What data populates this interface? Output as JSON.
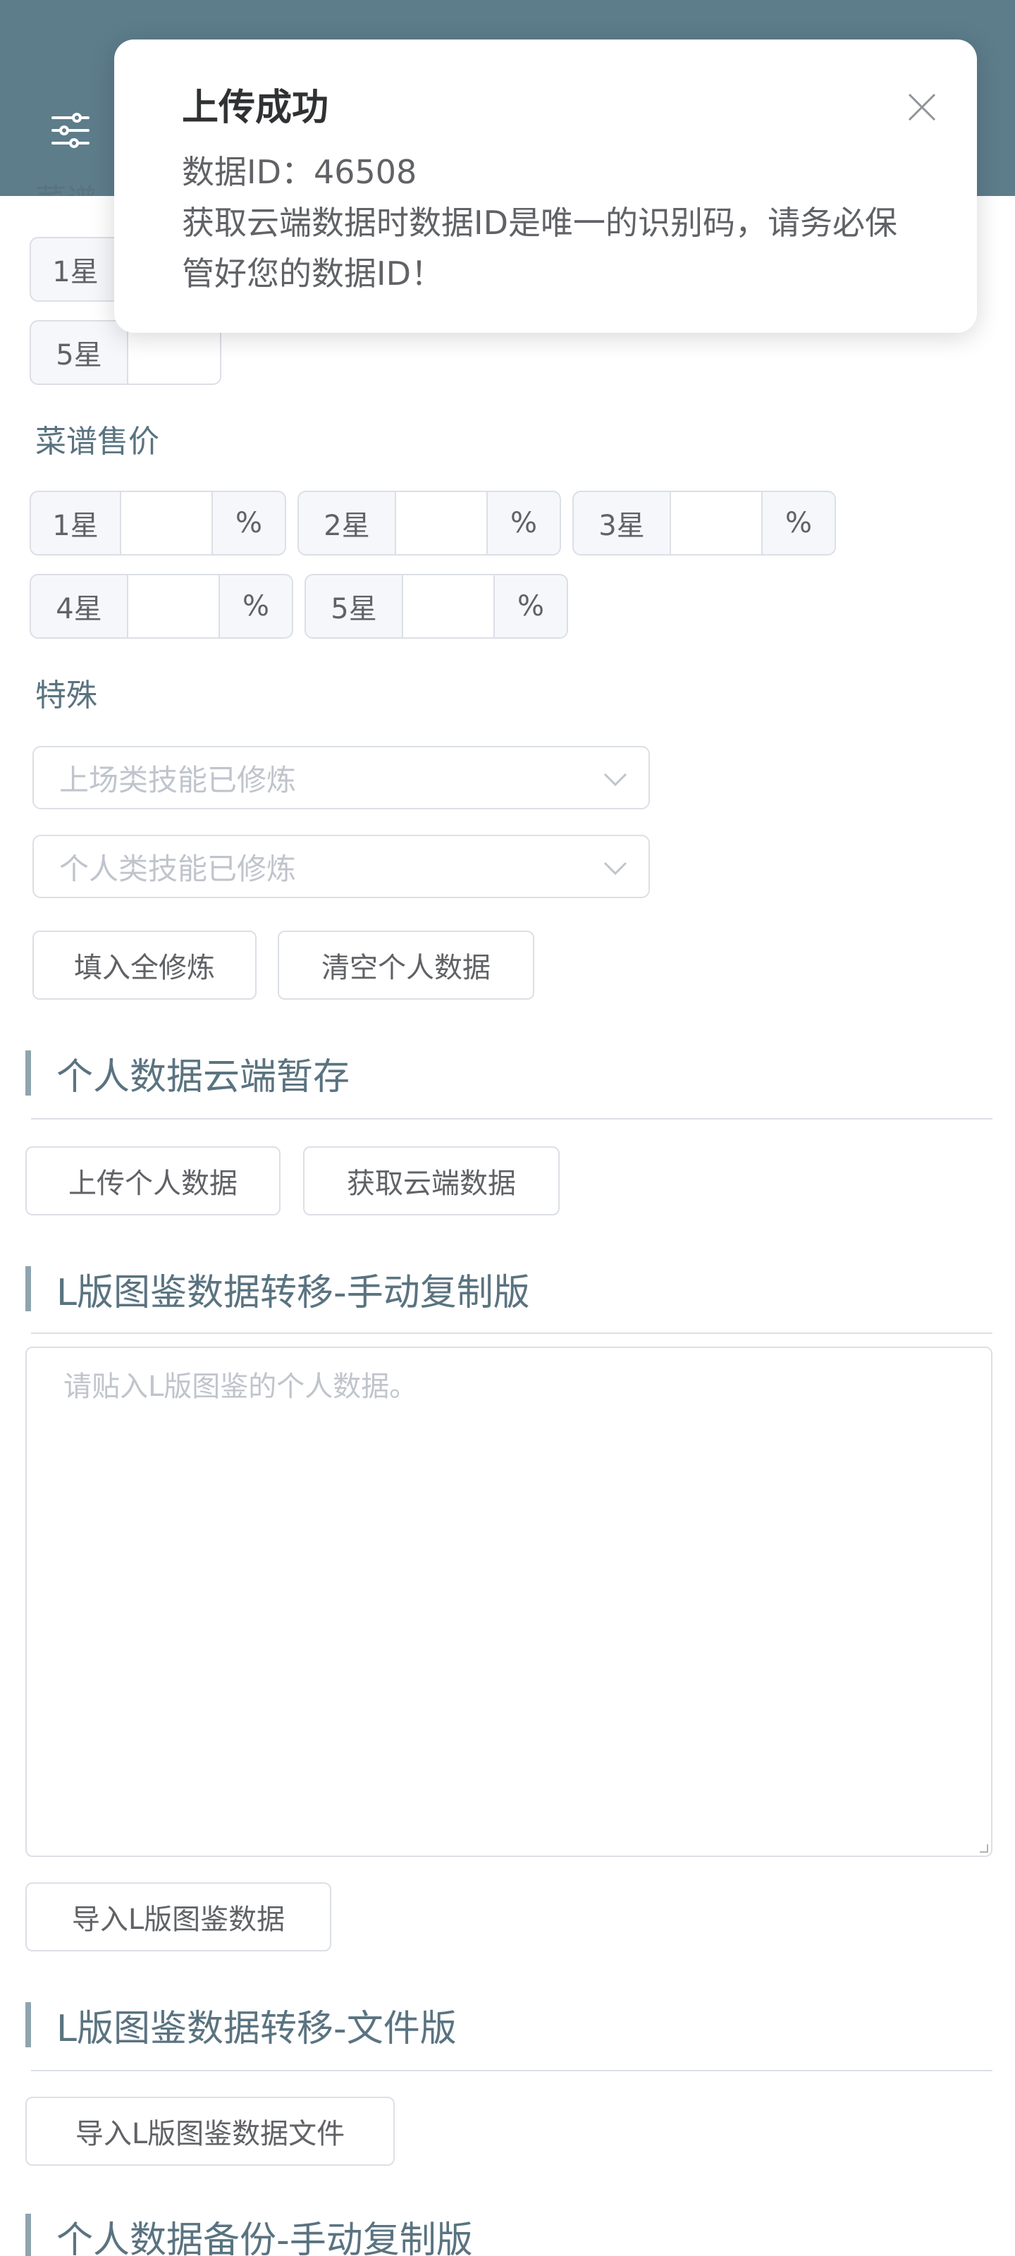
{
  "header": {
    "menu_icon": "sliders-icon",
    "background": "#5d7d8b"
  },
  "partial_top_label": "菜谱…",
  "rows_top": [
    {
      "prefix": "1星"
    },
    {
      "prefix": "5星"
    }
  ],
  "recipe_price": {
    "label": "菜谱售价",
    "items": [
      {
        "prefix": "1星",
        "suffix": "%"
      },
      {
        "prefix": "2星",
        "suffix": "%"
      },
      {
        "prefix": "3星",
        "suffix": "%"
      },
      {
        "prefix": "4星",
        "suffix": "%"
      },
      {
        "prefix": "5星",
        "suffix": "%"
      }
    ]
  },
  "special": {
    "label": "特殊",
    "select1_placeholder": "上场类技能已修炼",
    "select2_placeholder": "个人类技能已修炼",
    "btn_fill_all": "填入全修炼",
    "btn_clear": "清空个人数据"
  },
  "cloud": {
    "title": "个人数据云端暂存",
    "btn_upload": "上传个人数据",
    "btn_fetch": "获取云端数据"
  },
  "l_manual": {
    "title": "L版图鉴数据转移-手动复制版",
    "textarea_placeholder": "请贴入L版图鉴的个人数据。",
    "btn_import": "导入L版图鉴数据"
  },
  "l_file": {
    "title": "L版图鉴数据转移-文件版",
    "btn_import_file": "导入L版图鉴数据文件"
  },
  "backup": {
    "title": "个人数据备份-手动复制版"
  },
  "toast": {
    "title": "上传成功",
    "id_line": "数据ID：46508",
    "message": "获取云端数据时数据ID是唯一的识别码，请务必保管好您的数据ID！"
  }
}
